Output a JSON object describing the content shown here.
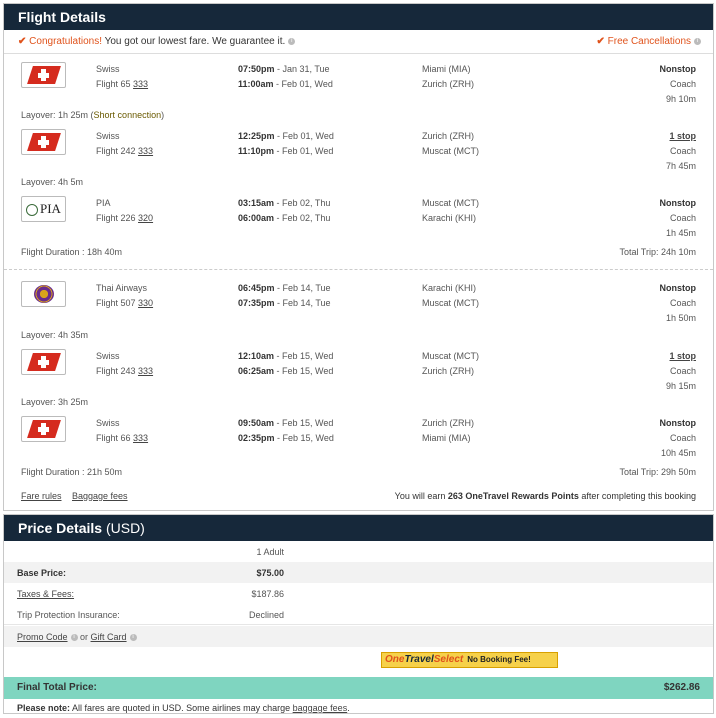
{
  "flight_details": {
    "title": "Flight Details",
    "congrats_label": "Congratulations!",
    "congrats_text": " You got our lowest fare. We guarantee it.",
    "free_cancel": "Free Cancellations",
    "outbound": {
      "segments": [
        {
          "airline": "Swiss",
          "flight_prefix": "Flight 65 ",
          "aircraft": "333",
          "dep_time": "07:50pm",
          "dep_date": " - Jan 31, Tue",
          "arr_time": "11:00am",
          "arr_date": " - Feb 01, Wed",
          "from": "Miami (MIA)",
          "to": "Zurich (ZRH)",
          "stops": "Nonstop",
          "cabin": "Coach",
          "duration": "9h 10m"
        },
        {
          "airline": "Swiss",
          "flight_prefix": "Flight 242 ",
          "aircraft": "333",
          "dep_time": "12:25pm",
          "dep_date": " - Feb 01, Wed",
          "arr_time": "11:10pm",
          "arr_date": " - Feb 01, Wed",
          "from": "Zurich (ZRH)",
          "to": "Muscat (MCT)",
          "stops": "1 stop",
          "cabin": "Coach",
          "duration": "7h 45m"
        },
        {
          "airline": "PIA",
          "flight_prefix": "Flight 226 ",
          "aircraft": "320",
          "dep_time": "03:15am",
          "dep_date": " - Feb 02, Thu",
          "arr_time": "06:00am",
          "arr_date": " - Feb 02, Thu",
          "from": "Muscat (MCT)",
          "to": "Karachi (KHI)",
          "stops": "Nonstop",
          "cabin": "Coach",
          "duration": "1h 45m"
        }
      ],
      "layover1": "Layover: 1h 25m (",
      "layover1_short": "Short connection",
      "layover1_end": ")",
      "layover2": "Layover: 4h 5m",
      "duration_label": "Flight Duration : 18h 40m",
      "total_trip": "Total Trip: 24h 10m"
    },
    "inbound": {
      "segments": [
        {
          "airline": "Thai Airways",
          "flight_prefix": "Flight 507 ",
          "aircraft": "330",
          "dep_time": "06:45pm",
          "dep_date": " - Feb 14, Tue",
          "arr_time": "07:35pm",
          "arr_date": " - Feb 14, Tue",
          "from": "Karachi (KHI)",
          "to": "Muscat (MCT)",
          "stops": "Nonstop",
          "cabin": "Coach",
          "duration": "1h 50m"
        },
        {
          "airline": "Swiss",
          "flight_prefix": "Flight 243 ",
          "aircraft": "333",
          "dep_time": "12:10am",
          "dep_date": " - Feb 15, Wed",
          "arr_time": "06:25am",
          "arr_date": " - Feb 15, Wed",
          "from": "Muscat (MCT)",
          "to": "Zurich (ZRH)",
          "stops": "1 stop",
          "cabin": "Coach",
          "duration": "9h 15m"
        },
        {
          "airline": "Swiss",
          "flight_prefix": "Flight 66 ",
          "aircraft": "333",
          "dep_time": "09:50am",
          "dep_date": " - Feb 15, Wed",
          "arr_time": "02:35pm",
          "arr_date": " - Feb 15, Wed",
          "from": "Zurich (ZRH)",
          "to": "Miami (MIA)",
          "stops": "Nonstop",
          "cabin": "Coach",
          "duration": "10h 45m"
        }
      ],
      "layover1": "Layover: 4h 35m",
      "layover2": "Layover: 3h 25m",
      "duration_label": "Flight Duration : 21h 50m",
      "total_trip": "Total Trip: 29h 50m"
    },
    "fare_rules": "Fare rules",
    "baggage_fees": "Baggage fees",
    "rewards_prefix": "You will earn ",
    "rewards_points": "263 OneTravel Rewards Points",
    "rewards_suffix": " after completing this booking"
  },
  "price_details": {
    "title": "Price Details",
    "currency": " (USD)",
    "adults": "1 Adult",
    "base_label": "Base Price:",
    "base_value": "$75.00",
    "taxes_label": "Taxes & Fees:",
    "taxes_value": "$187.86",
    "protection_label": "Trip Protection Insurance:",
    "protection_value": "Declined",
    "promo_label": "Promo Code",
    "or_text": " or ",
    "gift_label": "Gift Card",
    "ots_one": "One",
    "ots_travel": "Travel",
    "ots_select": "Select",
    "ots_fee": "No Booking Fee!",
    "final_label": "Final Total Price:",
    "final_value": "$262.86",
    "note_bold": "Please note:",
    "note_text": " All fares are quoted in USD. Some airlines may charge ",
    "note_link": "baggage fees",
    "note_end": "."
  }
}
